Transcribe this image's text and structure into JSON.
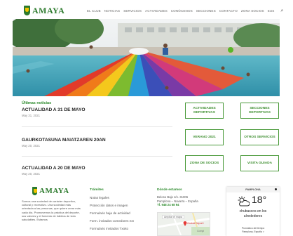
{
  "brand": {
    "name": "AMAYA",
    "green": "#2c7a2c",
    "gold": "#f2c400"
  },
  "nav": {
    "items": [
      "EL CLUB",
      "NOTICIAS",
      "SERVICIOS",
      "ACTIVIDADES",
      "CONÓCENOS",
      "SECCIONES",
      "CONTACTO",
      "ZONA SOCIOS",
      "EUS"
    ],
    "search_icon": "search-icon"
  },
  "news": {
    "heading": "Últimas noticias",
    "items": [
      {
        "title": "ACTUALIDAD A 31 DE MAYO",
        "date": "May 31, 2021"
      },
      {
        "title": "GAURKOTASUNA MAIATZAREN 20AN",
        "date": "May 20, 2021"
      },
      {
        "title": "ACTUALIDAD A 20 DE MAYO",
        "date": "May 20, 2021"
      }
    ]
  },
  "quick_buttons": [
    "ACTIVIDADES DEPORTIVAS",
    "SECCIONES DEPORTIVAS",
    "VERANO 2021",
    "OTROS SERVICIOS",
    "ZONA DE SOCIOS",
    "VISITA GUIADA"
  ],
  "footer": {
    "about": "Somos una sociedad de carácter deportivo, cultural y recreativo. Una sociedad más orientada a las personas, que quiere crear más cada día. Promovemos la práctica del deporte, sus valores y el fomento de hábitos de vida saludables. Estamos",
    "tramites": {
      "heading": "Trámites",
      "items": [
        "Notas legales",
        "Protección datos e imagen",
        "Formulario baja de actividad",
        "Form. invitados comedores ext",
        "Formulario invitados Txoko"
      ]
    },
    "donde": {
      "heading": "Dónde estamos",
      "address_1": "Beloso Bajo s/n. 31006",
      "address_2": "Pamplona – Navarra – España",
      "phone": "Tf. 948 24 68 94",
      "map_tag": "Ampliar el mapa",
      "map_place": "Ciudad Deporti",
      "map_zone": "Compl"
    },
    "weather": {
      "city": "PAMPLONA",
      "temp": "18°",
      "desc_1": "chubascos en los",
      "desc_2": "alrededores",
      "forecast": "Pronóstico del tiempo",
      "location": "Pamplona, España >"
    }
  }
}
